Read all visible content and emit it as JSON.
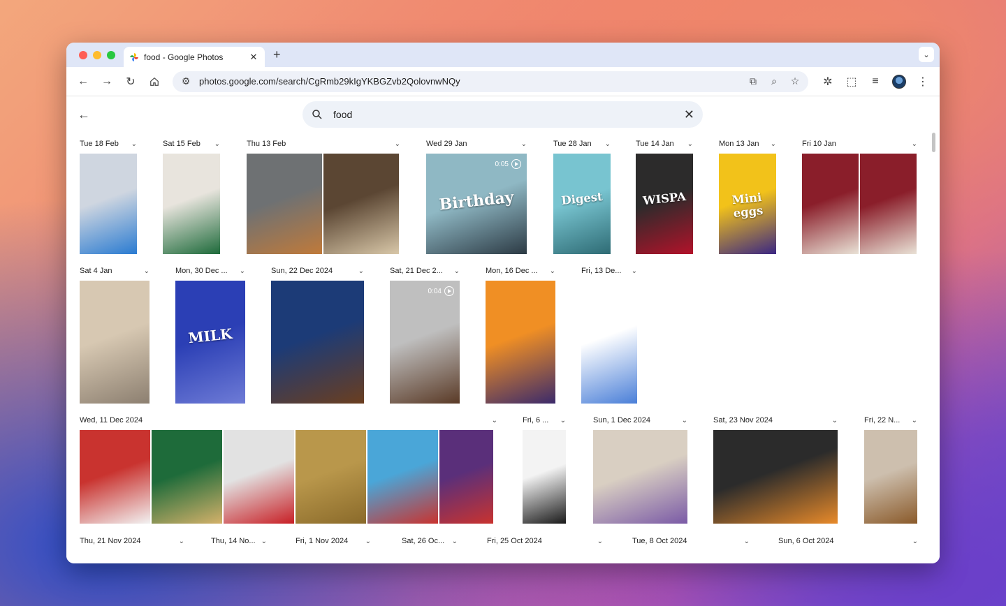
{
  "browser": {
    "tab_title": "food - Google Photos",
    "url": "photos.google.com/search/CgRmb29kIgYKBGZvb2QolovnwNQy"
  },
  "search": {
    "query": "food"
  },
  "rows": [
    [
      {
        "label": "Tue 18 Feb",
        "photos": [
          {
            "colors": [
              "#cfd6e0",
              "#2a7bd1"
            ]
          }
        ]
      },
      {
        "label": "Sat 15 Feb",
        "photos": [
          {
            "colors": [
              "#e8e4dd",
              "#1d6a3a"
            ]
          }
        ]
      },
      {
        "label": "Thu 13 Feb",
        "photos": [
          {
            "colors": [
              "#6e7173",
              "#c07a3a"
            ]
          },
          {
            "colors": [
              "#5b4633",
              "#d8c7a8"
            ]
          }
        ]
      },
      {
        "label": "Wed 29 Jan",
        "photos": [
          {
            "colors": [
              "#8fb8c4",
              "#2c3a44"
            ],
            "video": "0:05",
            "text": "Birthday"
          }
        ]
      },
      {
        "label": "Tue 28 Jan",
        "photos": [
          {
            "colors": [
              "#78c4d0",
              "#2e6b74"
            ],
            "text": "Digest"
          }
        ]
      },
      {
        "label": "Tue 14 Jan",
        "photos": [
          {
            "colors": [
              "#2c2b2b",
              "#b3122a"
            ],
            "text": "WISPA"
          }
        ]
      },
      {
        "label": "Mon 13 Jan",
        "photos": [
          {
            "colors": [
              "#f2c21a",
              "#3a2683"
            ],
            "text": "Mini eggs"
          }
        ]
      },
      {
        "label": "Fri 10 Jan",
        "photos": [
          {
            "colors": [
              "#8a1e2a",
              "#e9e2d6"
            ]
          },
          {
            "colors": [
              "#8a1e2a",
              "#e9e2d6"
            ]
          }
        ]
      }
    ],
    [
      {
        "label": "Sat 4 Jan",
        "photos": [
          {
            "colors": [
              "#d7c8b2",
              "#8c7f70"
            ]
          }
        ]
      },
      {
        "label": "Mon, 30 Dec ...",
        "photos": [
          {
            "colors": [
              "#2b3fb5",
              "#6e7bd6"
            ],
            "text": "MILK"
          }
        ]
      },
      {
        "label": "Sun, 22 Dec 2024",
        "photos": [
          {
            "colors": [
              "#1c3b77",
              "#6b3e1f"
            ]
          }
        ]
      },
      {
        "label": "Sat, 21 Dec 2...",
        "photos": [
          {
            "colors": [
              "#bfbfbf",
              "#5a3a26"
            ],
            "video": "0:04"
          }
        ]
      },
      {
        "label": "Mon, 16 Dec ...",
        "photos": [
          {
            "colors": [
              "#f08f24",
              "#3b2a6b"
            ]
          }
        ]
      },
      {
        "label": "Fri, 13 De...",
        "photos": [
          {
            "colors": [
              "#ffffff",
              "#4a7fd8"
            ]
          }
        ]
      }
    ],
    [
      {
        "label": "Wed, 11 Dec 2024",
        "photos": [
          {
            "colors": [
              "#c9332f",
              "#f2f2f2"
            ]
          },
          {
            "colors": [
              "#1e6b3a",
              "#d4b16a"
            ]
          },
          {
            "colors": [
              "#e2e2e2",
              "#c81f25"
            ]
          },
          {
            "colors": [
              "#b9974b",
              "#8a6a2a"
            ]
          },
          {
            "colors": [
              "#4aa6d8",
              "#c9332f"
            ]
          },
          {
            "colors": [
              "#5a2f7a",
              "#c9332f"
            ]
          }
        ]
      },
      {
        "label": "Fri, 6 ...",
        "photos": [
          {
            "colors": [
              "#f3f3f3",
              "#1a1a1a"
            ]
          }
        ]
      },
      {
        "label": "Sun, 1 Dec 2024",
        "photos": [
          {
            "colors": [
              "#d9cfc2",
              "#7a5aa6"
            ]
          }
        ]
      },
      {
        "label": "Sat, 23 Nov 2024",
        "photos": [
          {
            "colors": [
              "#2b2b2b",
              "#e88a2a"
            ]
          }
        ]
      },
      {
        "label": "Fri, 22 N...",
        "photos": [
          {
            "colors": [
              "#cdbfae",
              "#8a5a2a"
            ]
          }
        ]
      }
    ],
    [
      {
        "label": "Thu, 21 Nov 2024"
      },
      {
        "label": "Thu, 14 No..."
      },
      {
        "label": "Fri, 1 Nov 2024"
      },
      {
        "label": "Sat, 26 Oc..."
      },
      {
        "label": "Fri, 25 Oct 2024"
      },
      {
        "label": "Tue, 8 Oct 2024"
      },
      {
        "label": "Sun, 6 Oct 2024"
      }
    ]
  ]
}
